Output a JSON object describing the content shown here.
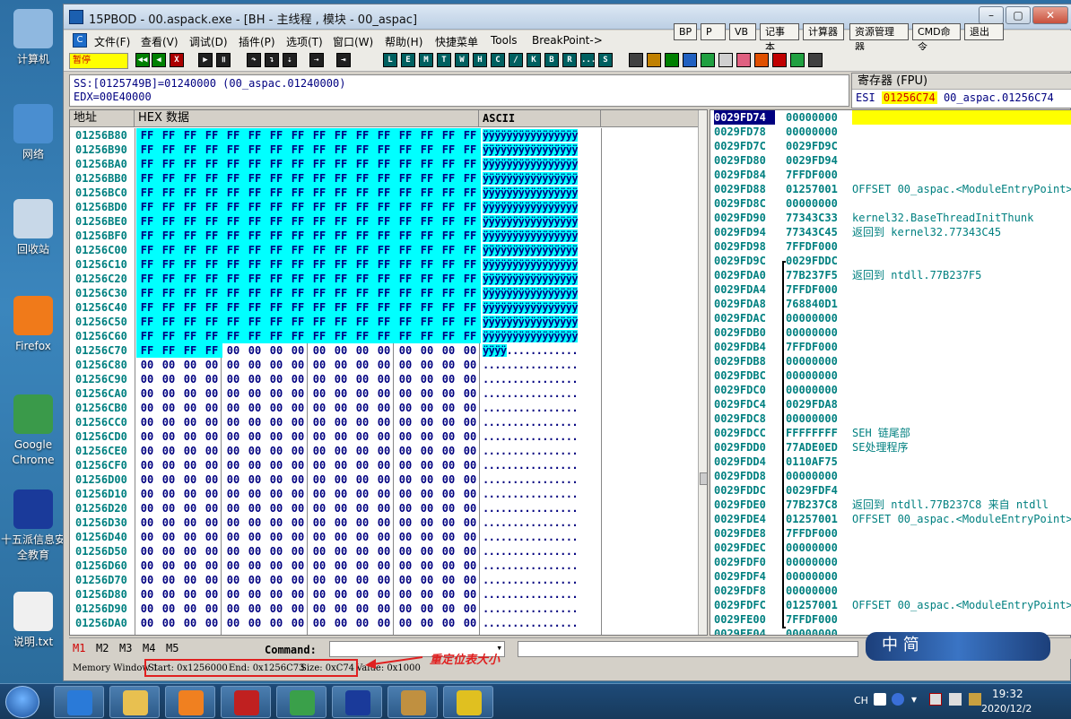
{
  "desktop": {
    "icons": [
      {
        "label": "计算机",
        "color": "#8fb8e0"
      },
      {
        "label": "网络",
        "color": "#4a8ed0"
      },
      {
        "label": "回收站",
        "color": "#c8d8e8"
      },
      {
        "label": "Firefox",
        "color": "#f07a1a"
      },
      {
        "label": "Google Chrome",
        "color": "#3a9a4a"
      },
      {
        "label": "十五派信息安全教育",
        "color": "#1a3a9a"
      },
      {
        "label": "说明.txt",
        "color": "#f0f0f0"
      }
    ]
  },
  "window": {
    "title": "15PBOD  - 00.aspack.exe - [BH - 主线程 , 模块 - 00_aspac]"
  },
  "menu": {
    "items": [
      "文件(F)",
      "查看(V)",
      "调试(D)",
      "插件(P)",
      "选项(T)",
      "窗口(W)",
      "帮助(H)",
      "快捷菜单",
      "Tools",
      "BreakPoint->"
    ]
  },
  "top_buttons": [
    "BP",
    "P",
    "VB",
    "记事本",
    "计算器",
    "资源管理器",
    "CMD命令",
    "退出"
  ],
  "toolbar": {
    "state_label": "暂停",
    "letter_buttons": [
      "L",
      "E",
      "M",
      "T",
      "W",
      "H",
      "C",
      "/",
      "K",
      "B",
      "R",
      "...",
      "S"
    ]
  },
  "info": {
    "line1": "SS:[0125749B]=01240000 (00_aspac.01240000)",
    "line2": "EDX=00E40000"
  },
  "registers": {
    "header": "寄存器 (FPU)",
    "esi_name": "ESI",
    "esi_value": "01256C74",
    "esi_comment": "00_aspac.01256C74"
  },
  "dump": {
    "headers": {
      "address": "地址",
      "hex": "HEX 数据",
      "ascii": "ASCII"
    },
    "rows": [
      {
        "addr": "01256B80",
        "ff": 16
      },
      {
        "addr": "01256B90",
        "ff": 16
      },
      {
        "addr": "01256BA0",
        "ff": 16
      },
      {
        "addr": "01256BB0",
        "ff": 16
      },
      {
        "addr": "01256BC0",
        "ff": 16
      },
      {
        "addr": "01256BD0",
        "ff": 16
      },
      {
        "addr": "01256BE0",
        "ff": 16
      },
      {
        "addr": "01256BF0",
        "ff": 16
      },
      {
        "addr": "01256C00",
        "ff": 16
      },
      {
        "addr": "01256C10",
        "ff": 16
      },
      {
        "addr": "01256C20",
        "ff": 16
      },
      {
        "addr": "01256C30",
        "ff": 16
      },
      {
        "addr": "01256C40",
        "ff": 16
      },
      {
        "addr": "01256C50",
        "ff": 16
      },
      {
        "addr": "01256C60",
        "ff": 16
      },
      {
        "addr": "01256C70",
        "ff": 4
      },
      {
        "addr": "01256C80",
        "ff": 0
      },
      {
        "addr": "01256C90",
        "ff": 0
      },
      {
        "addr": "01256CA0",
        "ff": 0
      },
      {
        "addr": "01256CB0",
        "ff": 0
      },
      {
        "addr": "01256CC0",
        "ff": 0
      },
      {
        "addr": "01256CD0",
        "ff": 0
      },
      {
        "addr": "01256CE0",
        "ff": 0
      },
      {
        "addr": "01256CF0",
        "ff": 0
      },
      {
        "addr": "01256D00",
        "ff": 0
      },
      {
        "addr": "01256D10",
        "ff": 0
      },
      {
        "addr": "01256D20",
        "ff": 0
      },
      {
        "addr": "01256D30",
        "ff": 0
      },
      {
        "addr": "01256D40",
        "ff": 0
      },
      {
        "addr": "01256D50",
        "ff": 0
      },
      {
        "addr": "01256D60",
        "ff": 0
      },
      {
        "addr": "01256D70",
        "ff": 0
      },
      {
        "addr": "01256D80",
        "ff": 0
      },
      {
        "addr": "01256D90",
        "ff": 0
      },
      {
        "addr": "01256DA0",
        "ff": 0
      }
    ]
  },
  "stack": {
    "rows": [
      {
        "addr": "0029FD74",
        "val": "00000000",
        "comment": ""
      },
      {
        "addr": "0029FD78",
        "val": "00000000",
        "comment": ""
      },
      {
        "addr": "0029FD7C",
        "val": "0029FD9C",
        "comment": ""
      },
      {
        "addr": "0029FD80",
        "val": "0029FD94",
        "comment": ""
      },
      {
        "addr": "0029FD84",
        "val": "7FFDF000",
        "comment": ""
      },
      {
        "addr": "0029FD88",
        "val": "01257001",
        "comment": "OFFSET 00_aspac.<ModuleEntryPoint>"
      },
      {
        "addr": "0029FD8C",
        "val": "00000000",
        "comment": ""
      },
      {
        "addr": "0029FD90",
        "val": "77343C33",
        "comment": "kernel32.BaseThreadInitThunk"
      },
      {
        "addr": "0029FD94",
        "val": "77343C45",
        "comment": "返回到 kernel32.77343C45"
      },
      {
        "addr": "0029FD98",
        "val": "7FFDF000",
        "comment": ""
      },
      {
        "addr": "0029FD9C",
        "val": "0029FDDC",
        "comment": ""
      },
      {
        "addr": "0029FDA0",
        "val": "77B237F5",
        "comment": "返回到 ntdll.77B237F5"
      },
      {
        "addr": "0029FDA4",
        "val": "7FFDF000",
        "comment": ""
      },
      {
        "addr": "0029FDA8",
        "val": "768840D1",
        "comment": ""
      },
      {
        "addr": "0029FDAC",
        "val": "00000000",
        "comment": ""
      },
      {
        "addr": "0029FDB0",
        "val": "00000000",
        "comment": ""
      },
      {
        "addr": "0029FDB4",
        "val": "7FFDF000",
        "comment": ""
      },
      {
        "addr": "0029FDB8",
        "val": "00000000",
        "comment": ""
      },
      {
        "addr": "0029FDBC",
        "val": "00000000",
        "comment": ""
      },
      {
        "addr": "0029FDC0",
        "val": "00000000",
        "comment": ""
      },
      {
        "addr": "0029FDC4",
        "val": "0029FDA8",
        "comment": ""
      },
      {
        "addr": "0029FDC8",
        "val": "00000000",
        "comment": ""
      },
      {
        "addr": "0029FDCC",
        "val": "FFFFFFFF",
        "comment": "SEH 链尾部"
      },
      {
        "addr": "0029FDD0",
        "val": "77ADE0ED",
        "comment": "SE处理程序"
      },
      {
        "addr": "0029FDD4",
        "val": "0110AF75",
        "comment": ""
      },
      {
        "addr": "0029FDD8",
        "val": "00000000",
        "comment": ""
      },
      {
        "addr": "0029FDDC",
        "val": "0029FDF4",
        "comment": ""
      },
      {
        "addr": "0029FDE0",
        "val": "77B237C8",
        "comment": "返回到 ntdll.77B237C8 来自 ntdll"
      },
      {
        "addr": "0029FDE4",
        "val": "01257001",
        "comment": "OFFSET 00_aspac.<ModuleEntryPoint>"
      },
      {
        "addr": "0029FDE8",
        "val": "7FFDF000",
        "comment": ""
      },
      {
        "addr": "0029FDEC",
        "val": "00000000",
        "comment": ""
      },
      {
        "addr": "0029FDF0",
        "val": "00000000",
        "comment": ""
      },
      {
        "addr": "0029FDF4",
        "val": "00000000",
        "comment": ""
      },
      {
        "addr": "0029FDF8",
        "val": "00000000",
        "comment": ""
      },
      {
        "addr": "0029FDFC",
        "val": "01257001",
        "comment": "OFFSET 00_aspac.<ModuleEntryPoint>"
      },
      {
        "addr": "0029FE00",
        "val": "7FFDF000",
        "comment": ""
      },
      {
        "addr": "0029FE04",
        "val": "00000000",
        "comment": ""
      }
    ]
  },
  "command": {
    "tabs": [
      "M1",
      "M2",
      "M3",
      "M4",
      "M5"
    ],
    "label": "Command:"
  },
  "status": {
    "window": "Memory Window 1",
    "start": "Start: 0x1256000",
    "end": "End: 0x1256C73",
    "size": "Size: 0xC74",
    "value": "Value: 0x1000",
    "annotation": "重定位表大小"
  },
  "ime": {
    "text": "中 简"
  },
  "tray": {
    "lang": "CH",
    "time": "19:32",
    "date": "2020/12/2"
  },
  "colors": {
    "ff_highlight": "#00ffff",
    "address": "#008080",
    "hex": "#000080",
    "annotation": "#e02020"
  }
}
